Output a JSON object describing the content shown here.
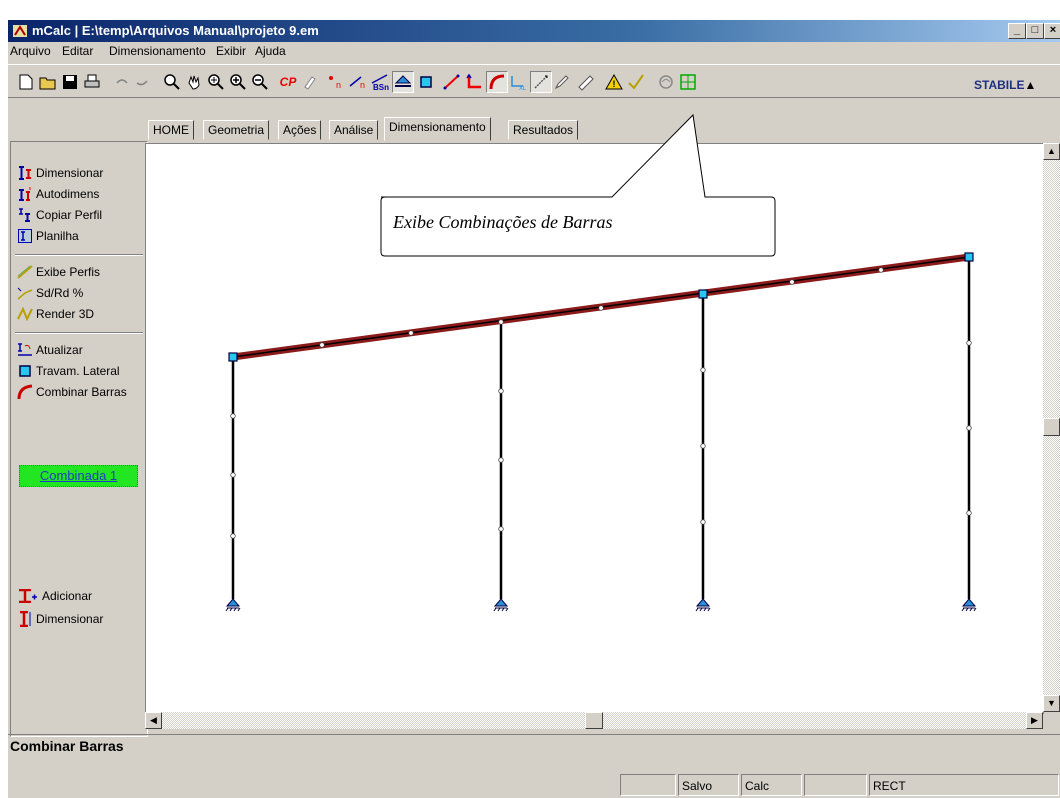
{
  "window": {
    "title": "mCalc | E:\\temp\\Arquivos Manual\\projeto 9.em",
    "min": "_",
    "max": "□",
    "close": "×"
  },
  "menu": [
    "Arquivo",
    "Editar",
    "Dimensionamento",
    "Exibir",
    "Ajuda"
  ],
  "toolbar": {
    "cp_label": "CP",
    "bsn_label": "BSn",
    "stabile_label": "STABILE"
  },
  "tabs": [
    "HOME",
    "Geometria",
    "Ações",
    "Análise",
    "Dimensionamento",
    "Resultados"
  ],
  "active_tab": "Dimensionamento",
  "sidebar": {
    "group1": [
      "Dimensionar",
      "Autodimens",
      "Copiar Perfil",
      "Planilha"
    ],
    "group2": [
      "Exibe Perfis",
      "Sd/Rd %",
      "Render 3D"
    ],
    "group3": [
      "Atualizar",
      "Travam. Lateral",
      "Combinar Barras"
    ],
    "combination": "Combinada 1",
    "group4": [
      "Adicionar",
      "Dimensionar"
    ]
  },
  "callout": "Exibe Combinações de Barras",
  "status_message": "Combinar Barras",
  "statusbar": [
    "",
    "Salvo",
    "Calc",
    "",
    "RECT"
  ],
  "colors": {
    "beam": "#8b1a1a",
    "node": "#29c6f0",
    "support": "#2a8fd8",
    "combination_bg": "#22e622"
  }
}
